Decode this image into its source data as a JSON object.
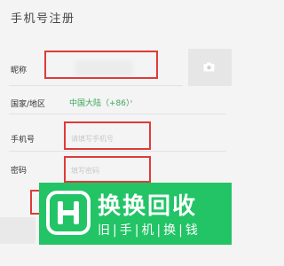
{
  "header": {
    "title": "手机号注册"
  },
  "form": {
    "nickname": {
      "label": "昵称"
    },
    "region": {
      "label": "国家/地区",
      "value": "中国大陆（+86）"
    },
    "phone": {
      "label": "手机号",
      "placeholder": "请填写手机号"
    },
    "password": {
      "label": "密码",
      "placeholder": "填写密码"
    }
  },
  "avatar": {
    "icon": "camera-icon"
  },
  "watermark": {
    "title": "换换回收",
    "subtitle": "旧|手|机|换|钱",
    "color": "#22c466"
  },
  "colors": {
    "highlight": "#e03a3a",
    "accent": "#3aa55a"
  }
}
